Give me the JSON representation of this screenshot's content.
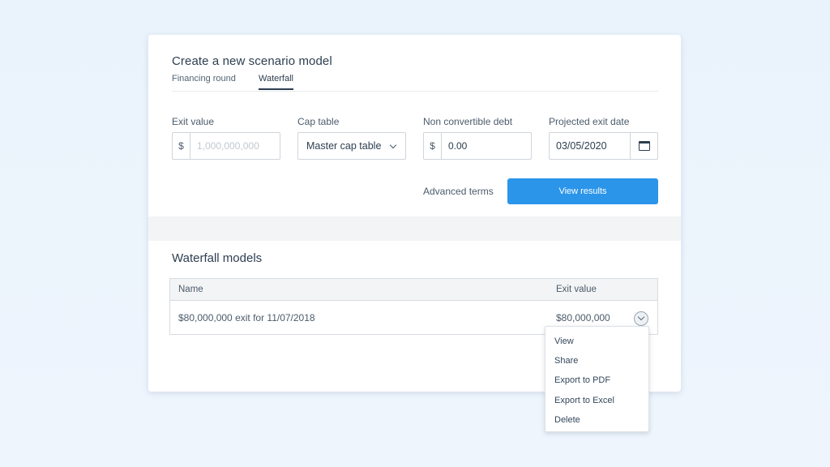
{
  "page": {
    "title": "Create a new scenario model"
  },
  "tabs": [
    {
      "label": "Financing round"
    },
    {
      "label": "Waterfall"
    }
  ],
  "form": {
    "exit_value": {
      "label": "Exit value",
      "prefix": "$",
      "placeholder": "1,000,000,000",
      "value": ""
    },
    "cap_table": {
      "label": "Cap table",
      "selected": "Master cap table"
    },
    "non_convertible_debt": {
      "label": "Non convertible debt",
      "prefix": "$",
      "value": "0.00"
    },
    "projected_exit_date": {
      "label": "Projected exit date",
      "value": "03/05/2020"
    }
  },
  "actions": {
    "advanced_terms": "Advanced terms",
    "view_results": "View results"
  },
  "models": {
    "title": "Waterfall models",
    "columns": [
      "Name",
      "Exit value"
    ],
    "rows": [
      {
        "name": "$80,000,000 exit for 11/07/2018",
        "exit_value": "$80,000,000"
      }
    ]
  },
  "row_menu": {
    "items": [
      "View",
      "Share",
      "Export to PDF",
      "Export to Excel",
      "Delete"
    ]
  },
  "colors": {
    "primary": "#2b95ea",
    "text": "#2d3e50",
    "border": "#cfd5db"
  }
}
